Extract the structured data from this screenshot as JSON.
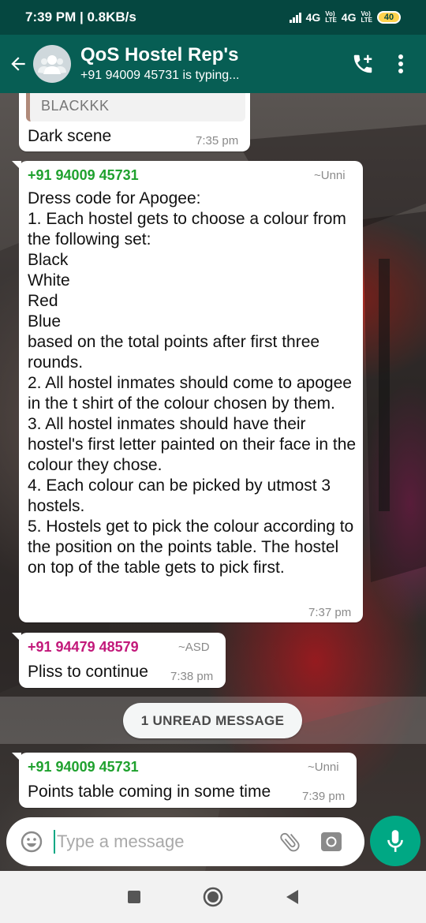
{
  "status_bar": {
    "time": "7:39 PM",
    "speed": "0.8KB/s",
    "network_1": "4G",
    "network_2": "4G",
    "lte_label": "LTE",
    "volte_label": "Vo)",
    "battery": "40"
  },
  "header": {
    "title": "QoS Hostel Rep's",
    "subtitle": "+91 94009 45731 is typing..."
  },
  "messages": [
    {
      "quoted_text": "BLACKKK",
      "text": "Dark scene",
      "time": "7:35 pm"
    },
    {
      "sender_phone": "+91 94009 45731",
      "sender_name": "~Unni",
      "sender_color": "#1fa12e",
      "text": "Dress code for Apogee:\n1. Each hostel gets to choose a colour from the following set:\nBlack\nWhite\nRed\nBlue\nbased on the total points after first three rounds.\n2. All hostel inmates should come to apogee in the t shirt of the colour chosen by them.\n3. All hostel inmates should have their hostel's first letter painted on their face in the colour they chose.\n4. Each colour can be picked by utmost 3 hostels.\n5. Hostels get to pick the colour according to the position on the points table. The hostel on top of the table gets to pick first.",
      "time": "7:37 pm"
    },
    {
      "sender_phone": "+91 94479 48579",
      "sender_name": "~ASD",
      "sender_color": "#c2187a",
      "text": "Pliss to continue",
      "time": "7:38 pm"
    },
    {
      "sender_phone": "+91 94009 45731",
      "sender_name": "~Unni",
      "sender_color": "#1fa12e",
      "text": "Points table coming in some time",
      "time": "7:39 pm"
    }
  ],
  "unread_banner": "1 UNREAD MESSAGE",
  "composer": {
    "placeholder": "Type a message"
  },
  "colors": {
    "status_bar": "#054740",
    "app_bar": "#075e54",
    "accent": "#00a884"
  },
  "icons": [
    "back-arrow-icon",
    "group-avatar-icon",
    "add-call-icon",
    "more-vert-icon",
    "emoji-icon",
    "attach-icon",
    "camera-icon",
    "mic-icon",
    "nav-recents-icon",
    "nav-home-icon",
    "nav-back-icon"
  ]
}
